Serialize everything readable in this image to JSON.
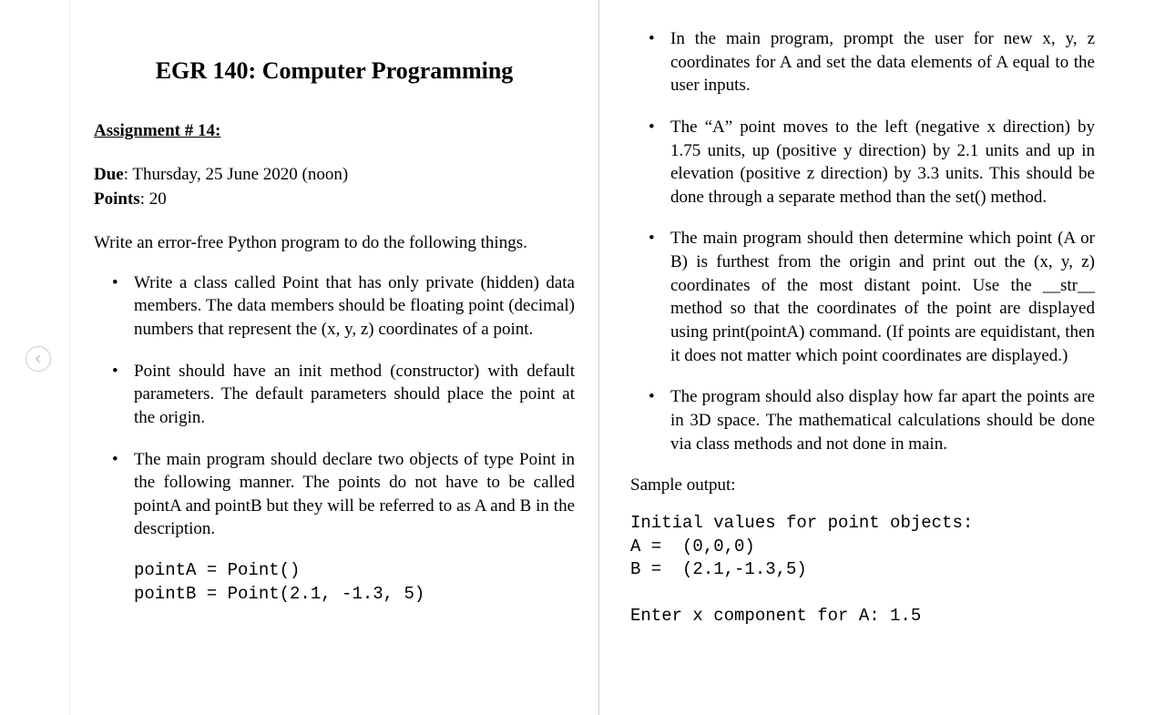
{
  "course_title": "EGR 140: Computer Programming",
  "assignment_label": "Assignment # 14:",
  "due_label": "Due",
  "due_value": ": Thursday, 25 June 2020 (noon)",
  "points_label": "Points",
  "points_value": ": 20",
  "intro_text": "Write an error-free Python program to do the following things.",
  "left_bullets": [
    "Write a class called Point that has only private (hidden) data members.  The data members should be floating point (decimal) numbers that represent the (x, y, z) coordinates of a point.",
    "Point should have an init method (constructor) with default parameters. The default parameters should place the point at the origin.",
    "The main program should declare two objects of type Point in the following manner. The points do not have to be called pointA and pointB but they will be referred to as A and B in the description."
  ],
  "code_block": "pointA = Point()\npointB = Point(2.1, -1.3, 5)",
  "right_bullets": [
    "In the main program, prompt the user for new x, y, z coordinates for A and set the data elements of A equal to the user inputs.",
    "The “A” point moves to the left (negative x direction) by 1.75 units, up (positive y direction) by 2.1 units and up in elevation (positive z direction) by 3.3 units. This should be done through a separate method than the set() method.",
    "The main program should then determine which point (A or B) is furthest from the origin and print out the (x, y, z) coordinates of the most distant point. Use the __str__ method so that the coordinates of the point are displayed using print(pointA) command. (If points are equidistant, then it does not matter which point coordinates are displayed.)",
    "The program should also display how far apart the points are in 3D space. The mathematical calculations should be done via class methods and not done in main."
  ],
  "sample_label": "Sample output:",
  "sample_output": "Initial values for point objects:\nA =  (0,0,0)\nB =  (2.1,-1.3,5)\n\nEnter x component for A: 1.5"
}
